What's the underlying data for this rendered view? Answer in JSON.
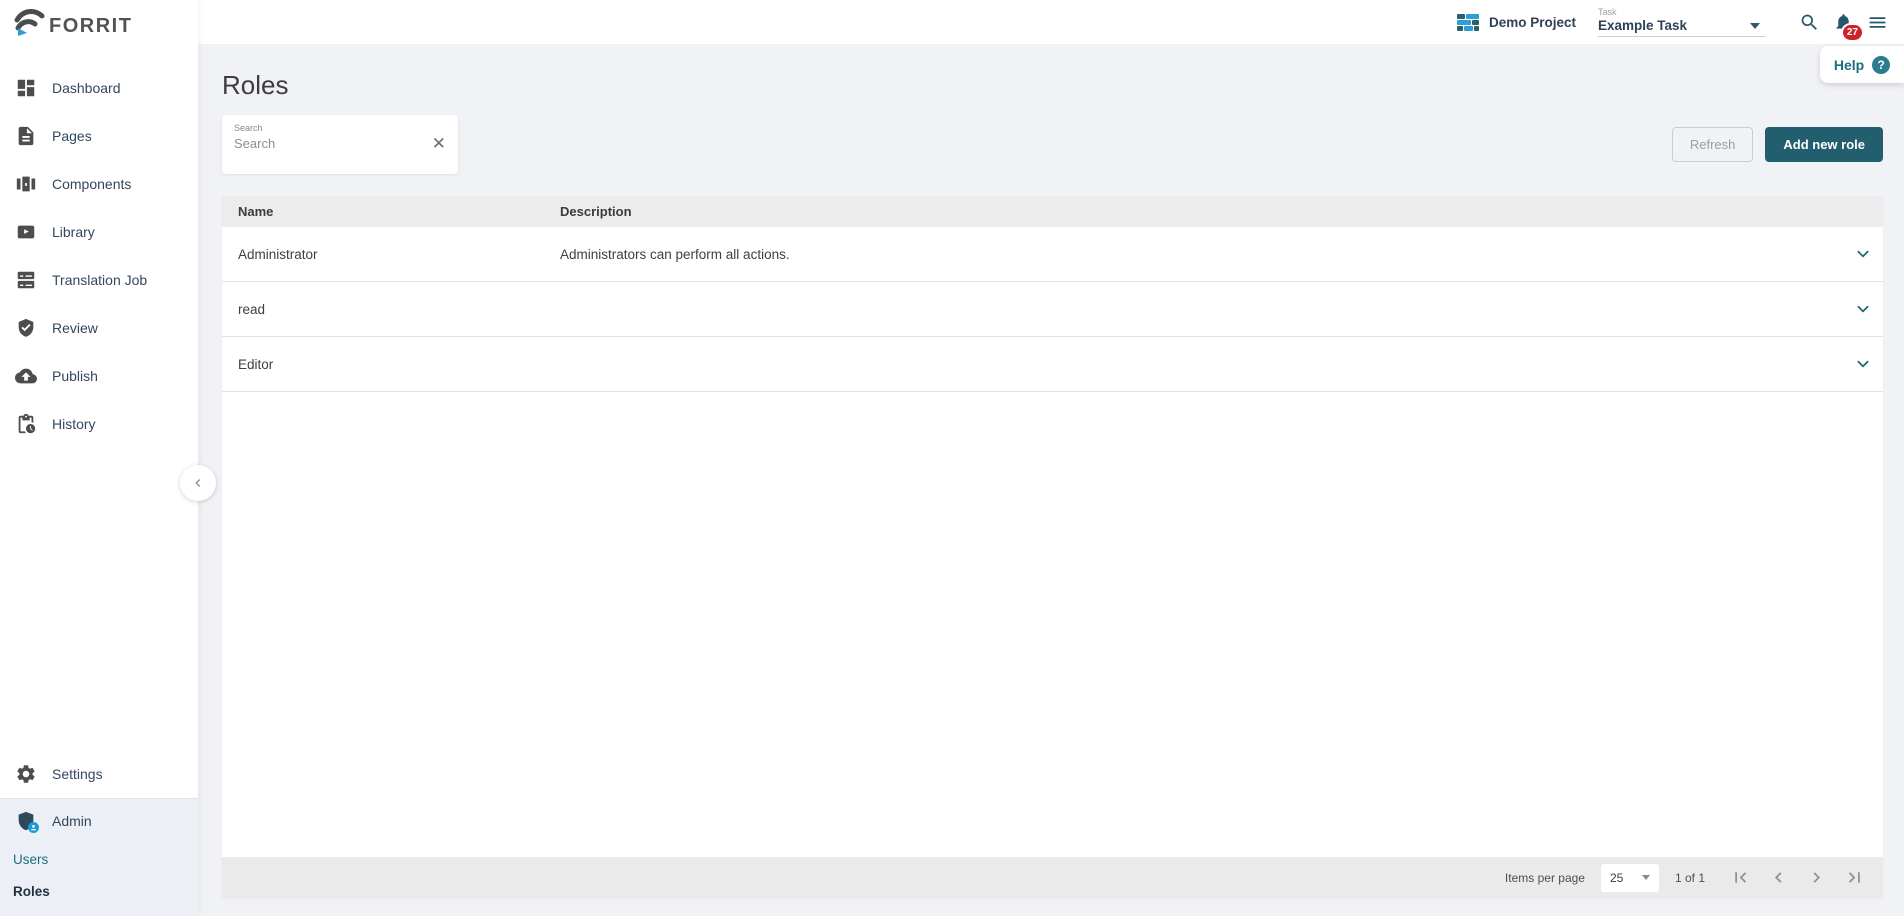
{
  "app": {
    "logo_text": "FORRIT"
  },
  "topbar": {
    "project_label": "Demo Project",
    "task_label": "Task",
    "task_value": "Example Task",
    "notification_count": "27",
    "help_label": "Help"
  },
  "sidebar": {
    "items": [
      {
        "label": "Dashboard"
      },
      {
        "label": "Pages"
      },
      {
        "label": "Components"
      },
      {
        "label": "Library"
      },
      {
        "label": "Translation Job"
      },
      {
        "label": "Review"
      },
      {
        "label": "Publish"
      },
      {
        "label": "History"
      }
    ],
    "settings_label": "Settings",
    "admin_label": "Admin",
    "admin_children": [
      {
        "label": "Users"
      },
      {
        "label": "Roles"
      }
    ]
  },
  "page": {
    "title": "Roles",
    "search_label": "Search",
    "search_placeholder": "Search",
    "refresh_label": "Refresh",
    "add_role_label": "Add new role",
    "table": {
      "columns": {
        "name": "Name",
        "description": "Description"
      },
      "rows": [
        {
          "name": "Administrator",
          "description": "Administrators can perform all actions."
        },
        {
          "name": "read",
          "description": ""
        },
        {
          "name": "Editor",
          "description": ""
        }
      ]
    },
    "pagination": {
      "items_per_page_label": "Items per page",
      "page_size": "25",
      "range_label": "1 of 1"
    }
  },
  "colors": {
    "accent_teal": "#235e6f",
    "link_teal": "#1d6d80",
    "badge_red": "#d0222d",
    "brand_blue": "#2e9fd4"
  }
}
